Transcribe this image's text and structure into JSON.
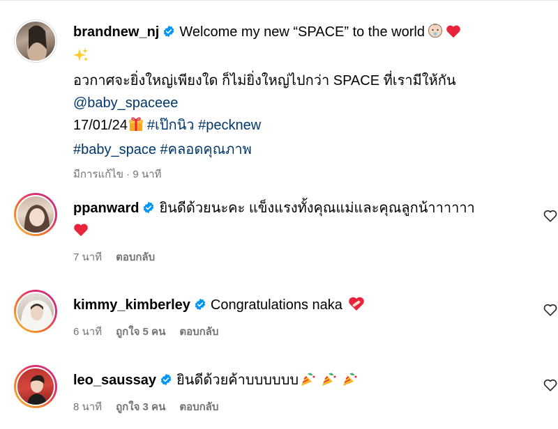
{
  "caption": {
    "username": "brandnew_nj",
    "text_line1": "Welcome my new “SPACE” to the world",
    "text_line3": "อวกาศจะยิ่งใหญ่เพียงใด ก็ไม่ยิ่งใหญ่ไปกว่า SPACE ที่เรามีให้กัน",
    "mention": "@baby_spaceee",
    "date": "17/01/24",
    "hashtags_line1": [
      "#เป๊กนิว",
      "#pecknew"
    ],
    "hashtags_line2": [
      "#baby_space",
      "#คลอดคุณภาพ"
    ],
    "edited": "มีการแก้ไข · 9 นาที"
  },
  "comments": [
    {
      "username": "ppanward",
      "text": "ยินดีด้วยนะคะ แข็งแรงทั้งคุณแม่และคุณลูกน้าาาาาา",
      "time": "7 นาที",
      "likes": "",
      "reply": "ตอบกลับ"
    },
    {
      "username": "kimmy_kimberley",
      "text": "Congratulations naka",
      "time": "6 นาที",
      "likes": "ถูกใจ 5 คน",
      "reply": "ตอบกลับ"
    },
    {
      "username": "leo_saussay",
      "text": "ยินดีด้วยค้าบบบบบบ",
      "time": "8 นาที",
      "likes": "ถูกใจ 3 คน",
      "reply": "ตอบกลับ"
    }
  ],
  "colors": {
    "link": "#00376b",
    "verified": "#0095f6",
    "meta": "#737373",
    "heart": "#e0245e"
  }
}
